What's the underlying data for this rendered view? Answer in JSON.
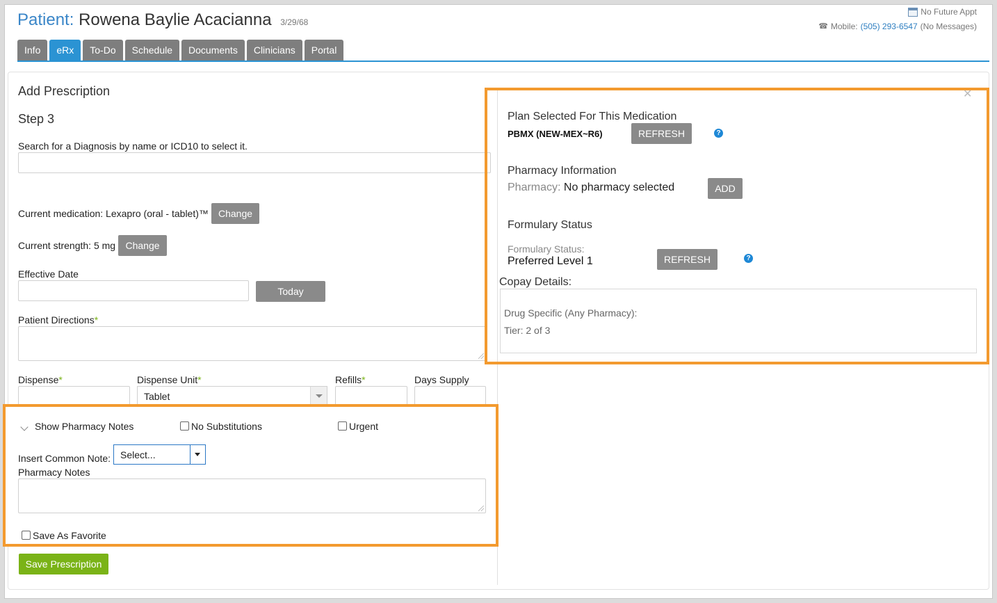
{
  "header": {
    "patient_label": "Patient:",
    "patient_name": "Rowena Baylie Acacianna",
    "dob": "3/29/68",
    "appt_status": "No Future Appt",
    "mobile_label": "Mobile:",
    "mobile_number": "(505) 293-6547",
    "messages": "(No Messages)"
  },
  "tabs": [
    {
      "label": "Info",
      "active": false
    },
    {
      "label": "eRx",
      "active": true
    },
    {
      "label": "To-Do",
      "active": false
    },
    {
      "label": "Schedule",
      "active": false
    },
    {
      "label": "Documents",
      "active": false
    },
    {
      "label": "Clinicians",
      "active": false
    },
    {
      "label": "Portal",
      "active": false
    }
  ],
  "form": {
    "title": "Add Prescription",
    "step": "Step 3",
    "diagnosis_label": "Search for a Diagnosis by name or ICD10 to select it.",
    "diagnosis_value": "",
    "current_medication_label": "Current medication: Lexapro (oral - tablet)™",
    "change_label": "Change",
    "current_strength_label": "Current strength: 5 mg",
    "effective_date_label": "Effective Date",
    "effective_date_value": "",
    "today_label": "Today",
    "patient_directions_label": "Patient Directions",
    "required_mark": "*",
    "dispense_label": "Dispense",
    "dispense_unit_label": "Dispense Unit",
    "dispense_unit_value": "Tablet",
    "refills_label": "Refills",
    "days_supply_label": "Days Supply",
    "show_pharmacy_notes": "Show Pharmacy Notes",
    "no_substitutions": "No Substitutions",
    "urgent": "Urgent",
    "insert_common_note_label": "Insert Common Note:",
    "insert_common_note_value": "Select...",
    "pharmacy_notes_label": "Pharmacy Notes",
    "save_as_favorite": "Save As Favorite",
    "save_button": "Save Prescription"
  },
  "plan": {
    "heading": "Plan Selected For This Medication",
    "value": "PBMX (NEW-MEX~R6)",
    "refresh_label": "REFRESH",
    "help": "?"
  },
  "pharmacy": {
    "heading": "Pharmacy Information",
    "label": "Pharmacy:",
    "value": "No pharmacy selected",
    "add_label": "ADD"
  },
  "formulary": {
    "heading": "Formulary Status",
    "status_label": "Formulary Status:",
    "status_value": "Preferred Level 1",
    "refresh_label": "REFRESH",
    "help": "?"
  },
  "copay": {
    "heading": "Copay Details:",
    "line1": "Drug Specific (Any Pharmacy):",
    "line2": "Tier: 2 of 3"
  },
  "colors": {
    "accent_blue": "#2b93d3",
    "highlight_orange": "#f39a2f",
    "save_green": "#7ab317",
    "button_gray": "#8a8a8a"
  }
}
